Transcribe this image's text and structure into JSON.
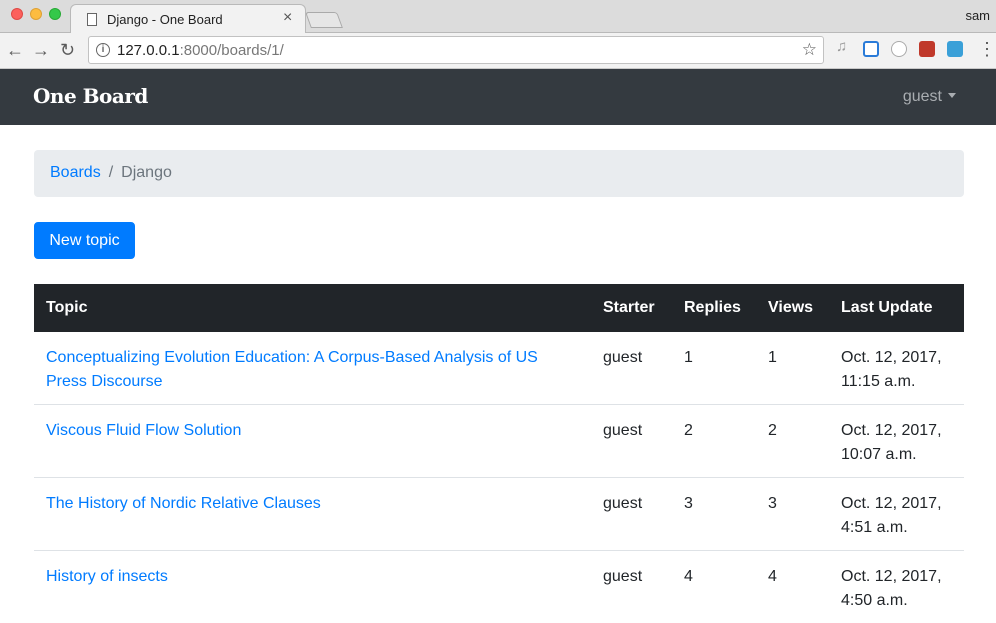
{
  "browser": {
    "tab_title": "Django - One Board",
    "tab_close": "×",
    "profile": "sam",
    "url_host": "127.0.0.1",
    "url_path": ":8000/boards/1/"
  },
  "navbar": {
    "brand": "One Board",
    "user": "guest"
  },
  "breadcrumb": {
    "link": "Boards",
    "separator": "/",
    "active": "Django"
  },
  "actions": {
    "new_topic": "New topic"
  },
  "table": {
    "headers": [
      "Topic",
      "Starter",
      "Replies",
      "Views",
      "Last Update"
    ],
    "rows": [
      {
        "topic": "Conceptualizing Evolution Education: A Corpus-Based Analysis of US Press Discourse",
        "starter": "guest",
        "replies": "1",
        "views": "1",
        "last_update": "Oct. 12, 2017, 11:15 a.m."
      },
      {
        "topic": "Viscous Fluid Flow Solution",
        "starter": "guest",
        "replies": "2",
        "views": "2",
        "last_update": "Oct. 12, 2017, 10:07 a.m."
      },
      {
        "topic": "The History of Nordic Relative Clauses",
        "starter": "guest",
        "replies": "3",
        "views": "3",
        "last_update": "Oct. 12, 2017, 4:51 a.m."
      },
      {
        "topic": "History of insects",
        "starter": "guest",
        "replies": "4",
        "views": "4",
        "last_update": "Oct. 12, 2017, 4:50 a.m."
      }
    ]
  },
  "icons": {
    "back": "back-arrow-icon",
    "forward": "forward-arrow-icon",
    "reload": "reload-icon",
    "info": "info-icon",
    "star": "bookmark-star-icon",
    "menu": "menu-dots-icon"
  }
}
